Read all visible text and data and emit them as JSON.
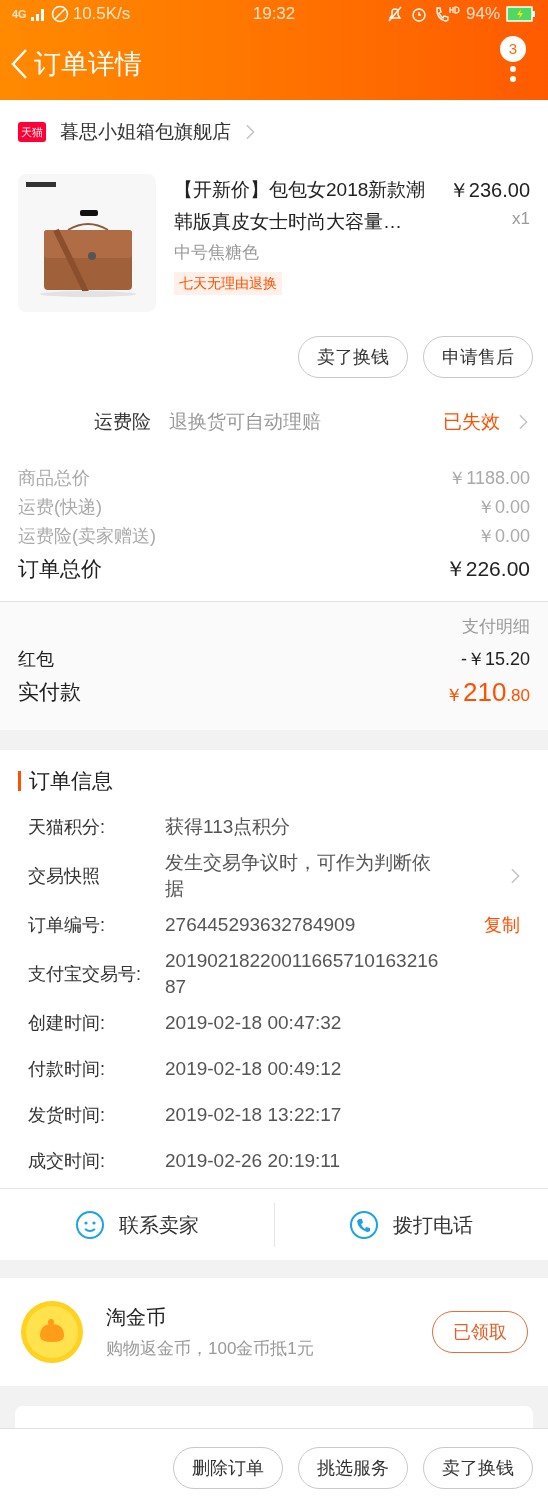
{
  "status_bar": {
    "network": "4G",
    "speed": "10.5K/s",
    "time": "19:32",
    "battery": "94%"
  },
  "nav": {
    "title": "订单详情",
    "badge": "3"
  },
  "store": {
    "badge": "天猫",
    "name": "暮思小姐箱包旗舰店"
  },
  "product": {
    "title": "【开新价】包包女2018新款潮韩版真皮女士时尚大容量…",
    "price": "￥236.00",
    "quantity": "x1",
    "sku": "中号焦糖色",
    "tag": "七天无理由退换",
    "actions": [
      "卖了换钱",
      "申请售后"
    ]
  },
  "insurance": {
    "label": "运费险",
    "desc": "退换货可自动理赔",
    "status": "已失效"
  },
  "price_rows": [
    {
      "label": "商品总价",
      "value": "￥1188.00",
      "kind": "minor"
    },
    {
      "label": "运费(快递)",
      "value": "￥0.00",
      "kind": "minor"
    },
    {
      "label": "运费险(卖家赠送)",
      "value": "￥0.00",
      "kind": "minor"
    },
    {
      "label": "订单总价",
      "value": "￥226.00",
      "kind": "total"
    }
  ],
  "payment": {
    "title": "支付明细",
    "rows": [
      {
        "label": "红包",
        "value": "-￥15.20"
      }
    ],
    "paid_label": "实付款",
    "paid_currency": "￥",
    "paid_int": "210",
    "paid_dec": ".80"
  },
  "order_info": {
    "title": "订单信息",
    "rows": [
      {
        "label": "天猫积分:",
        "value": "获得113点积分",
        "kind": "plain"
      },
      {
        "label": "交易快照",
        "value": "发生交易争议时，可作为判断依据",
        "kind": "link"
      },
      {
        "label": "订单编号:",
        "value": "276445293632784909",
        "kind": "copy",
        "action": "复制"
      },
      {
        "label": "支付宝交易号:",
        "value": "2019021822001166571016321687",
        "kind": "plain"
      },
      {
        "label": "创建时间:",
        "value": "2019-02-18 00:47:32",
        "kind": "plain"
      },
      {
        "label": "付款时间:",
        "value": "2019-02-18 00:49:12",
        "kind": "plain"
      },
      {
        "label": "发货时间:",
        "value": "2019-02-18 13:22:17",
        "kind": "plain"
      },
      {
        "label": "成交时间:",
        "value": "2019-02-26 20:19:11",
        "kind": "plain"
      }
    ]
  },
  "contact": [
    {
      "label": "联系卖家",
      "kind": "chat"
    },
    {
      "label": "拨打电话",
      "kind": "phone"
    }
  ],
  "coins": {
    "title": "淘金币",
    "desc": "购物返金币，100金币抵1元",
    "button": "已领取"
  },
  "bottom_actions": [
    "删除订单",
    "挑选服务",
    "卖了换钱"
  ]
}
